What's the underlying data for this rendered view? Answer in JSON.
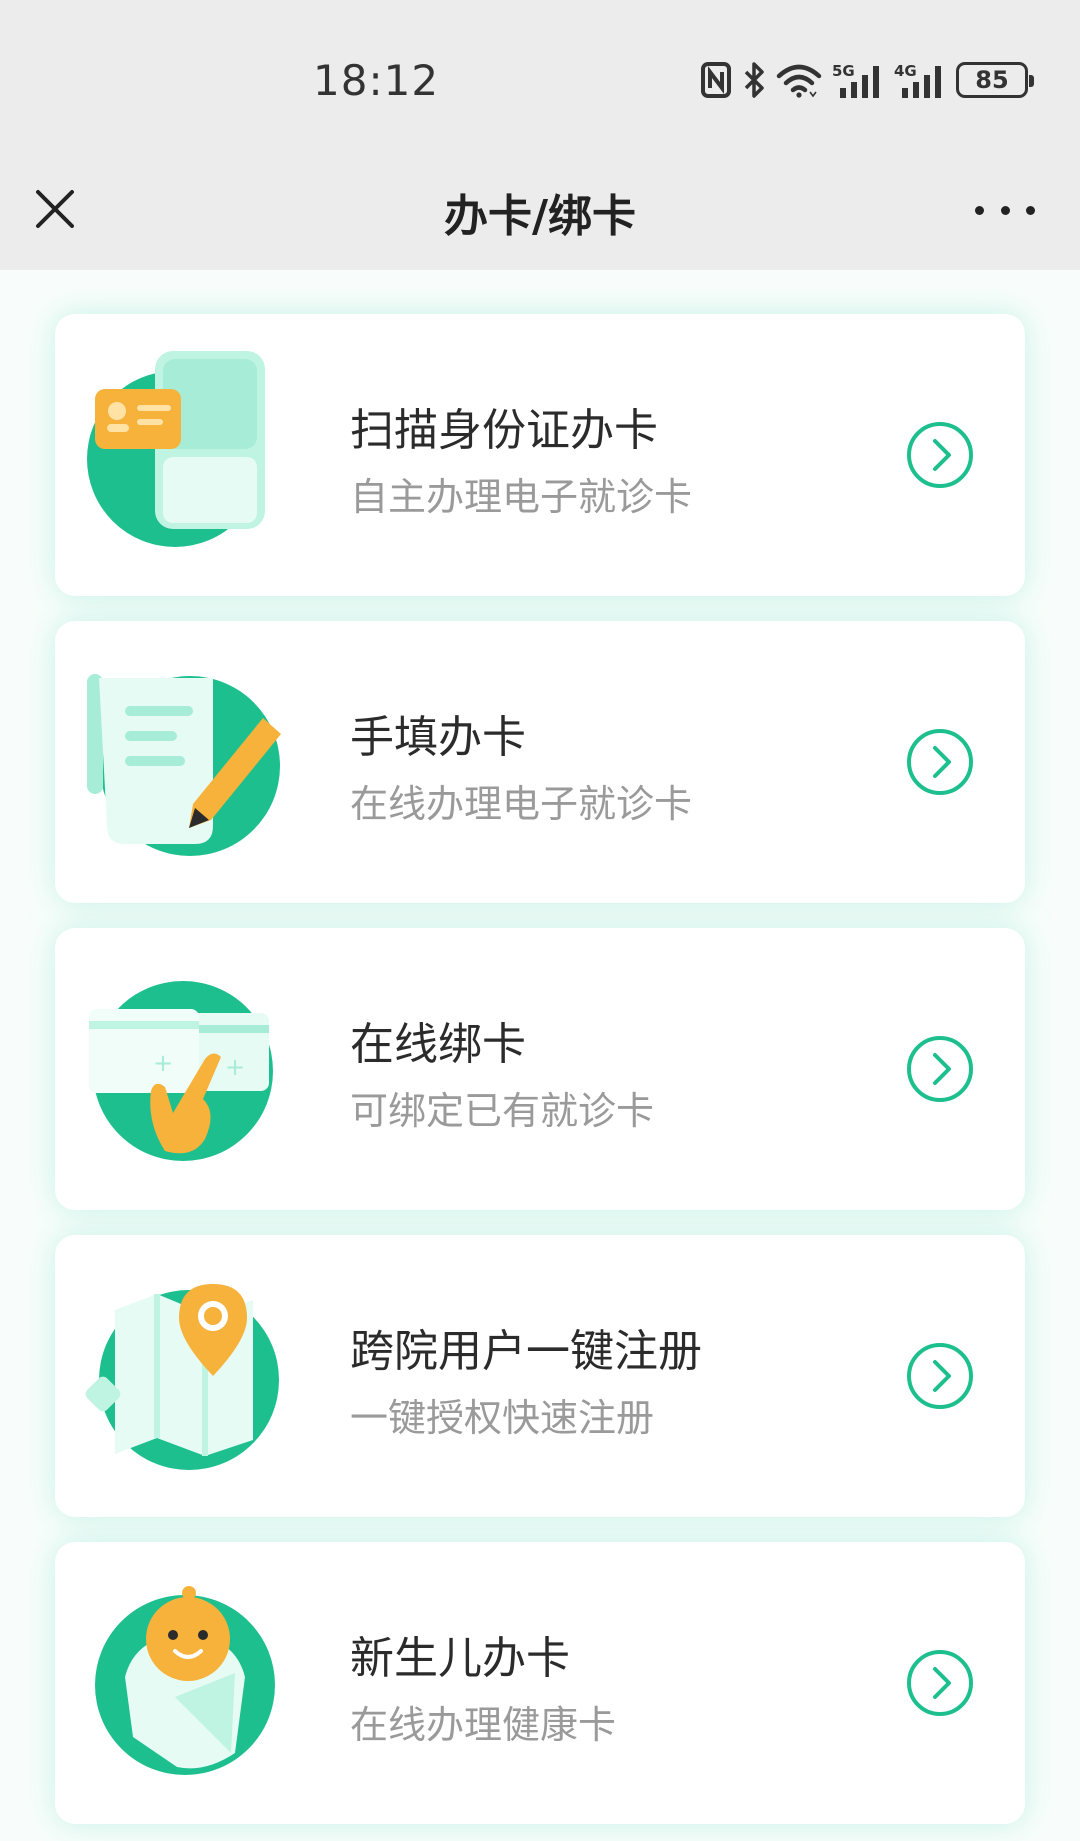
{
  "status_bar": {
    "time": "18:12",
    "icons": [
      "nfc-icon",
      "bluetooth-icon",
      "wifi-icon",
      "5g-signal-icon",
      "4g-signal-icon",
      "battery-icon"
    ],
    "network_5g": "5G",
    "network_4g": "4G",
    "battery_level": "85"
  },
  "nav": {
    "title": "办卡/绑卡",
    "close_icon": "close-icon",
    "more_icon": "more-icon"
  },
  "colors": {
    "accent": "#1dbf8e",
    "accent_light": "#bff3e2",
    "orange": "#f6b23b"
  },
  "options": [
    {
      "title": "扫描身份证办卡",
      "subtitle": "自主办理电子就诊卡",
      "icon": "id-card-scan-icon"
    },
    {
      "title": "手填办卡",
      "subtitle": "在线办理电子就诊卡",
      "icon": "form-pencil-icon"
    },
    {
      "title": "在线绑卡",
      "subtitle": "可绑定已有就诊卡",
      "icon": "card-bind-icon"
    },
    {
      "title": "跨院用户一键注册",
      "subtitle": "一键授权快速注册",
      "icon": "location-map-icon"
    },
    {
      "title": "新生儿办卡",
      "subtitle": "在线办理健康卡",
      "icon": "newborn-icon"
    }
  ]
}
